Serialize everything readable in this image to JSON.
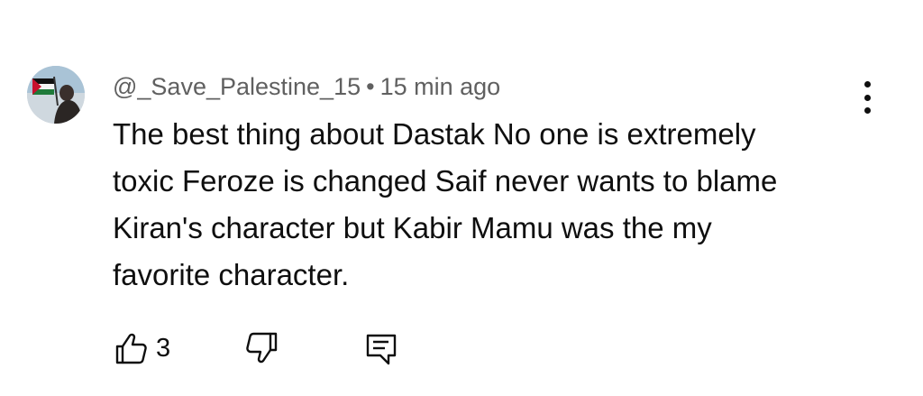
{
  "comment": {
    "author": "@_Save_Palestine_15",
    "separator": "•",
    "time": "15 min ago",
    "text_lines": [
      "The best thing about Dastak No one is extremely",
      "toxic Feroze is changed Saif never wants to blame",
      "Kiran's character but Kabir Mamu was the my",
      "favorite character."
    ],
    "like_count": "3"
  },
  "icons": {
    "avatar": "avatar-flag-icon",
    "like": "thumbs-up-icon",
    "dislike": "thumbs-down-icon",
    "reply": "reply-comment-icon",
    "menu": "more-vert-icon"
  },
  "colors": {
    "text": "#0f0f0f",
    "meta": "#606060",
    "background": "#ffffff"
  }
}
